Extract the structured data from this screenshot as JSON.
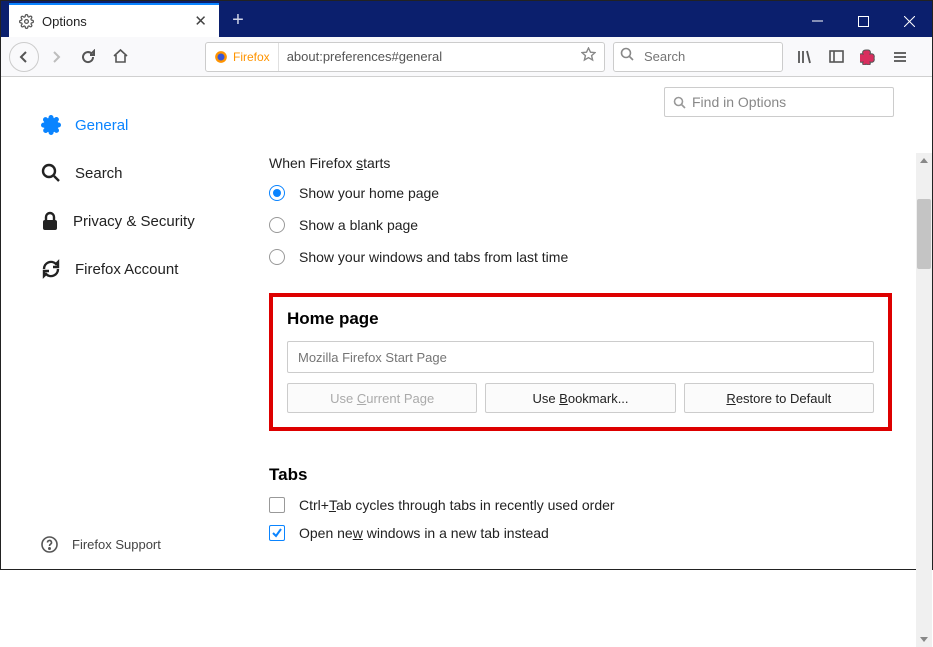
{
  "tab": {
    "title": "Options"
  },
  "urlbar": {
    "identity": "Firefox",
    "url": "about:preferences#general"
  },
  "searchbar": {
    "placeholder": "Search"
  },
  "sidebar": {
    "items": [
      {
        "label": "General"
      },
      {
        "label": "Search"
      },
      {
        "label": "Privacy & Security"
      },
      {
        "label": "Firefox Account"
      }
    ],
    "support": "Firefox Support"
  },
  "find": {
    "placeholder": "Find in Options"
  },
  "startup": {
    "heading_prefix": "When Firefox ",
    "heading_underline": "s",
    "heading_suffix": "tarts",
    "opt1": "Show your home page",
    "opt2": "Show a blank page",
    "opt3": "Show your windows and tabs from last time"
  },
  "homepage": {
    "title": "Home page",
    "value": "Mozilla Firefox Start Page",
    "btn1_pre": "Use ",
    "btn1_u": "C",
    "btn1_post": "urrent Page",
    "btn2_pre": "Use ",
    "btn2_u": "B",
    "btn2_post": "ookmark...",
    "btn3_u": "R",
    "btn3_post": "estore to Default"
  },
  "tabs": {
    "title": "Tabs",
    "opt1_pre": "Ctrl+",
    "opt1_u": "T",
    "opt1_post": "ab cycles through tabs in recently used order",
    "opt2_pre": "Open ne",
    "opt2_u": "w",
    "opt2_post": " windows in a new tab instead"
  }
}
